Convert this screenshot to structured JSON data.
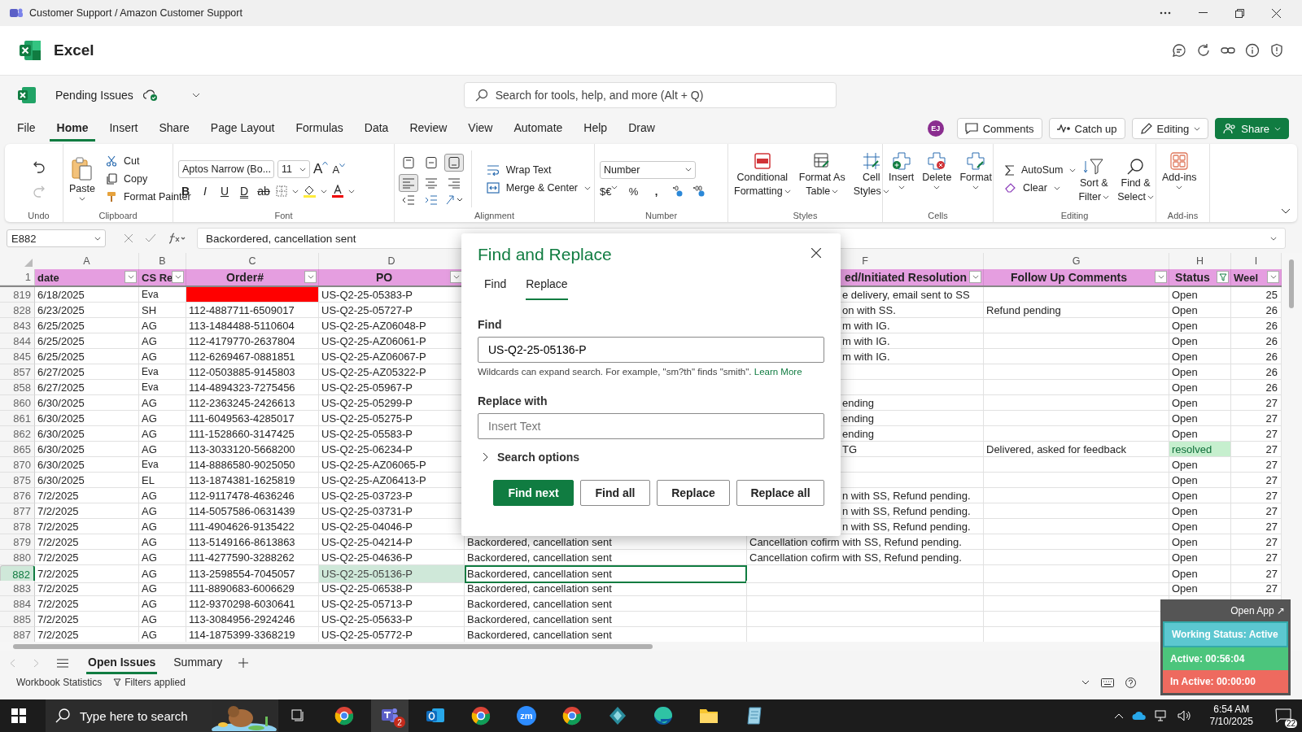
{
  "window": {
    "title": "Customer Support / Amazon Customer Support"
  },
  "app_name": "Excel",
  "workbook": {
    "name": "Pending Issues"
  },
  "search": {
    "placeholder": "Search for tools, help, and more (Alt + Q)"
  },
  "menu_tabs": [
    {
      "label": "File",
      "selected": false
    },
    {
      "label": "Home",
      "selected": true
    },
    {
      "label": "Insert",
      "selected": false
    },
    {
      "label": "Share",
      "selected": false
    },
    {
      "label": "Page Layout",
      "selected": false
    },
    {
      "label": "Formulas",
      "selected": false
    },
    {
      "label": "Data",
      "selected": false
    },
    {
      "label": "Review",
      "selected": false
    },
    {
      "label": "View",
      "selected": false
    },
    {
      "label": "Automate",
      "selected": false
    },
    {
      "label": "Help",
      "selected": false
    },
    {
      "label": "Draw",
      "selected": false
    }
  ],
  "user_initials": "EJ",
  "header_buttons": [
    {
      "label": "Comments",
      "kind": "comments"
    },
    {
      "label": "Catch up",
      "kind": "catchup"
    },
    {
      "label": "Editing",
      "kind": "editing"
    },
    {
      "label": "Share",
      "kind": "share"
    }
  ],
  "ribbon": {
    "undo": {
      "label": "Undo",
      "redo_disabled": true
    },
    "clipboard": {
      "label": "Clipboard",
      "paste": "Paste",
      "cut": "Cut",
      "copy": "Copy",
      "painter": "Format Painter"
    },
    "font": {
      "label": "Font",
      "font_name": "Aptos Narrow (Bo...",
      "font_size": "11",
      "grow": "A",
      "shrink": "A",
      "styles": [
        "B",
        "I",
        "U",
        "D",
        "ab"
      ]
    },
    "alignment": {
      "label": "Alignment",
      "wrap": "Wrap Text",
      "merge": "Merge & Center",
      "valign": [
        {
          "selected": false
        },
        {
          "selected": false
        },
        {
          "selected": true
        }
      ],
      "halign": [
        {
          "selected": true
        },
        {
          "selected": false
        },
        {
          "selected": false
        }
      ]
    },
    "number": {
      "label": "Number",
      "format": "Number",
      "currency": "$€",
      "percent": "%",
      "comma": ","
    },
    "styles": {
      "label": "Styles",
      "buttons": [
        {
          "lines": [
            "Conditional",
            "Formatting"
          ],
          "kind": "conditional"
        },
        {
          "lines": [
            "Format As",
            "Table"
          ],
          "kind": "table"
        },
        {
          "lines": [
            "Cell",
            "Styles"
          ],
          "kind": "cellstyles"
        }
      ]
    },
    "cells": {
      "label": "Cells",
      "buttons": [
        {
          "lines": [
            "Insert"
          ],
          "kind": "insert"
        },
        {
          "lines": [
            "Delete"
          ],
          "kind": "delete"
        },
        {
          "lines": [
            "Format"
          ],
          "kind": "format"
        }
      ]
    },
    "editing": {
      "label": "Editing",
      "autosum": "AutoSum",
      "clear": "Clear",
      "buttons": [
        {
          "lines": [
            "Sort &",
            "Filter"
          ],
          "kind": "sort"
        },
        {
          "lines": [
            "Find &",
            "Select"
          ],
          "kind": "find"
        }
      ]
    },
    "addins": {
      "label": "Add-ins",
      "button": "Add-ins"
    }
  },
  "formula_bar": {
    "name_box": "E882",
    "formula": "Backordered, cancellation sent"
  },
  "header_row_number": "1",
  "columns": [
    {
      "letter": "A",
      "header": "date",
      "filtered": false
    },
    {
      "letter": "B",
      "header": "CS Re",
      "filtered": false
    },
    {
      "letter": "C",
      "header": "Order#",
      "filtered": false
    },
    {
      "letter": "D",
      "header": "PO",
      "filtered": false
    },
    {},
    {
      "letter": "F",
      "header": "ed/Initiated Resolution",
      "filtered": false
    },
    {
      "letter": "G",
      "header": "Follow Up Comments",
      "filtered": false
    },
    {
      "letter": "H",
      "header": "Status",
      "filtered": true
    },
    {
      "letter": "I",
      "header": "Weel",
      "filtered": false
    }
  ],
  "rows": [
    {
      "n": "819",
      "date": "6/18/2025",
      "rep": "Eva",
      "order_flagged": true,
      "po": "US-Q2-25-05383-P",
      "resolution": "e delivery, email sent to SS",
      "status": "Open",
      "status_highlight": false,
      "week": "25",
      "selected": false
    },
    {
      "n": "828",
      "date": "6/23/2025",
      "rep": "SH",
      "order": "112-4887711-6509017",
      "order_flagged": false,
      "po": "US-Q2-25-05727-P",
      "resolution": "on with SS.",
      "comment": "Refund pending",
      "status": "Open",
      "status_highlight": false,
      "week": "26",
      "selected": false
    },
    {
      "n": "843",
      "date": "6/25/2025",
      "rep": "AG",
      "order": "113-1484488-5110604",
      "order_flagged": false,
      "po": "US-Q2-25-AZ06048-P",
      "resolution": "m with IG.",
      "status": "Open",
      "status_highlight": false,
      "week": "26",
      "selected": false
    },
    {
      "n": "844",
      "date": "6/25/2025",
      "rep": "AG",
      "order": "112-4179770-2637804",
      "order_flagged": false,
      "po": "US-Q2-25-AZ06061-P",
      "resolution": "m with IG.",
      "status": "Open",
      "status_highlight": false,
      "week": "26",
      "selected": false
    },
    {
      "n": "845",
      "date": "6/25/2025",
      "rep": "AG",
      "order": "112-6269467-0881851",
      "order_flagged": false,
      "po": "US-Q2-25-AZ06067-P",
      "resolution": "m with IG.",
      "status": "Open",
      "status_highlight": false,
      "week": "26",
      "selected": false
    },
    {
      "n": "857",
      "date": "6/27/2025",
      "rep": "Eva",
      "order": "112-0503885-9145803",
      "order_flagged": false,
      "po": "US-Q2-25-AZ05322-P",
      "status": "Open",
      "status_highlight": false,
      "week": "26",
      "selected": false
    },
    {
      "n": "858",
      "date": "6/27/2025",
      "rep": "Eva",
      "order": "114-4894323-7275456",
      "order_flagged": false,
      "po": "US-Q2-25-05967-P",
      "status": "Open",
      "status_highlight": false,
      "week": "26",
      "selected": false
    },
    {
      "n": "860",
      "date": "6/30/2025",
      "rep": "AG",
      "order": "112-2363245-2426613",
      "order_flagged": false,
      "po": "US-Q2-25-05299-P",
      "resolution": "ending",
      "status": "Open",
      "status_highlight": false,
      "week": "27",
      "selected": false
    },
    {
      "n": "861",
      "date": "6/30/2025",
      "rep": "AG",
      "order": "111-6049563-4285017",
      "order_flagged": false,
      "po": "US-Q2-25-05275-P",
      "resolution": "ending",
      "status": "Open",
      "status_highlight": false,
      "week": "27",
      "selected": false
    },
    {
      "n": "862",
      "date": "6/30/2025",
      "rep": "AG",
      "order": "111-1528660-3147425",
      "order_flagged": false,
      "po": "US-Q2-25-05583-P",
      "resolution": "ending",
      "status": "Open",
      "status_highlight": false,
      "week": "27",
      "selected": false
    },
    {
      "n": "865",
      "date": "6/30/2025",
      "rep": "AG",
      "order": "113-3033120-5668200",
      "order_flagged": false,
      "po": "US-Q2-25-06234-P",
      "resolution": "TG",
      "comment": "Delivered, asked for feedback",
      "status": "resolved",
      "status_highlight": true,
      "week": "27",
      "selected": false
    },
    {
      "n": "870",
      "date": "6/30/2025",
      "rep": "Eva",
      "order": "114-8886580-9025050",
      "order_flagged": false,
      "po": "US-Q2-25-AZ06065-P",
      "status": "Open",
      "status_highlight": false,
      "week": "27",
      "selected": false
    },
    {
      "n": "875",
      "date": "6/30/2025",
      "rep": "EL",
      "order": "113-1874381-1625819",
      "order_flagged": false,
      "po": "US-Q2-25-AZ06413-P",
      "status": "Open",
      "status_highlight": false,
      "week": "27",
      "selected": false
    },
    {
      "n": "876",
      "date": "7/2/2025",
      "rep": "AG",
      "order": "112-9117478-4636246",
      "order_flagged": false,
      "po": "US-Q2-25-03723-P",
      "resolution": "n with SS, Refund pending.",
      "status": "Open",
      "status_highlight": false,
      "week": "27",
      "selected": false
    },
    {
      "n": "877",
      "date": "7/2/2025",
      "rep": "AG",
      "order": "114-5057586-0631439",
      "order_flagged": false,
      "po": "US-Q2-25-03731-P",
      "resolution": "n with SS, Refund pending.",
      "status": "Open",
      "status_highlight": false,
      "week": "27",
      "selected": false
    },
    {
      "n": "878",
      "date": "7/2/2025",
      "rep": "AG",
      "order": "111-4904626-9135422",
      "order_flagged": false,
      "po": "US-Q2-25-04046-P",
      "resolution": "n with SS, Refund pending.",
      "status": "Open",
      "status_highlight": false,
      "week": "27",
      "selected": false
    },
    {
      "n": "879",
      "date": "7/2/2025",
      "rep": "AG",
      "order": "113-5149166-8613863",
      "order_flagged": false,
      "po": "US-Q2-25-04214-P",
      "action": "Backordered, cancellation sent",
      "resolution": "Cancellation cofirm with SS, Refund pending.",
      "status": "Open",
      "status_highlight": false,
      "week": "27",
      "selected": false
    },
    {
      "n": "880",
      "date": "7/2/2025",
      "rep": "AG",
      "order": "111-4277590-3288262",
      "order_flagged": false,
      "po": "US-Q2-25-04636-P",
      "action": "Backordered, cancellation sent",
      "resolution": "Cancellation cofirm with SS, Refund pending.",
      "status": "Open",
      "status_highlight": false,
      "week": "27",
      "selected": false
    },
    {
      "n": "882",
      "date": "7/2/2025",
      "rep": "AG",
      "order": "113-2598554-7045057",
      "order_flagged": false,
      "po": "US-Q2-25-05136-P",
      "action": "Backordered, cancellation sent",
      "status": "Open",
      "status_highlight": false,
      "week": "27",
      "selected": true
    },
    {
      "n": "883",
      "date": "7/2/2025",
      "rep": "AG",
      "order": "111-8890683-6006629",
      "order_flagged": false,
      "po": "US-Q2-25-06538-P",
      "action": "Backordered, cancellation sent",
      "status": "Open",
      "status_highlight": false,
      "week": "27",
      "selected": false
    },
    {
      "n": "884",
      "date": "7/2/2025",
      "rep": "AG",
      "order": "112-9370298-6030641",
      "order_flagged": false,
      "po": "US-Q2-25-05713-P",
      "action": "Backordered, cancellation sent",
      "status_highlight": false,
      "selected": false
    },
    {
      "n": "885",
      "date": "7/2/2025",
      "rep": "AG",
      "order": "113-3084956-2924246",
      "order_flagged": false,
      "po": "US-Q2-25-05633-P",
      "action": "Backordered, cancellation sent",
      "status_highlight": false,
      "selected": false
    },
    {
      "n": "887",
      "date": "7/2/2025",
      "rep": "AG",
      "order": "114-1875399-3368219",
      "order_flagged": false,
      "po": "US-Q2-25-05772-P",
      "action": "Backordered, cancellation sent",
      "status_highlight": false,
      "selected": false
    }
  ],
  "sheet_tabs": [
    {
      "label": "Open Issues",
      "selected": true
    },
    {
      "label": "Summary",
      "selected": false
    }
  ],
  "status_bar": {
    "statistics": "Workbook Statistics",
    "filters": "Filters applied"
  },
  "dialog": {
    "title": "Find and Replace",
    "tabs": [
      {
        "label": "Find",
        "selected": false
      },
      {
        "label": "Replace",
        "selected": true
      }
    ],
    "find_label": "Find",
    "find_value": "US-Q2-25-05136-P",
    "hint": "Wildcards can expand search. For example, \"sm?th\" finds \"smith\".",
    "link": "Learn More",
    "replace_label": "Replace with",
    "replace_placeholder": "Insert Text",
    "options": {
      "label": "Search options",
      "expanded": false
    },
    "buttons": [
      {
        "label": "Find next",
        "primary": true
      },
      {
        "label": "Find all",
        "primary": false
      },
      {
        "label": "Replace",
        "primary": false
      },
      {
        "label": "Replace all",
        "primary": false
      }
    ]
  },
  "tracker": {
    "open_app": "Open App ↗",
    "working": "Working Status: Active",
    "active": "Active: 00:56:04",
    "inactive": "In Active: 00:00:00"
  },
  "taskbar": {
    "search_placeholder": "Type here to search",
    "apps": [
      {
        "kind": "chrome",
        "selected": false
      },
      {
        "kind": "teams",
        "selected": true,
        "badge": "2"
      },
      {
        "kind": "outlook",
        "selected": false
      },
      {
        "kind": "chrome",
        "selected": false
      },
      {
        "kind": "zoom",
        "selected": false,
        "text": "zm"
      },
      {
        "kind": "chrome",
        "selected": false
      },
      {
        "kind": "diamond",
        "selected": false
      },
      {
        "kind": "edge",
        "selected": false
      },
      {
        "kind": "folder",
        "selected": false
      },
      {
        "kind": "notes",
        "selected": false
      }
    ],
    "time": "6:54 AM",
    "date": "7/10/2025",
    "notifications": "22"
  }
}
